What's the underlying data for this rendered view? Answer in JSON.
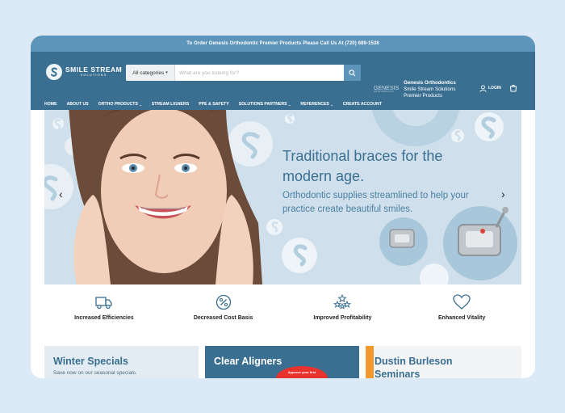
{
  "announcement": "To Order Genesis Orthodontic Premier Products Please Call Us At (720) 689-1536",
  "logo": {
    "line1": "SMILE STREAM",
    "line2": "SOLUTIONS"
  },
  "search": {
    "category": "All categories",
    "placeholder": "What are you looking for?"
  },
  "partner": {
    "logo_main": "GENESIS",
    "logo_sub": "ORTHODONTICS",
    "title": "Genesis Orthodontics",
    "line2": "Smile Stream Solutions",
    "line3": "Premier Products"
  },
  "account": {
    "login": "LOGIN"
  },
  "nav": [
    {
      "label": "HOME"
    },
    {
      "label": "ABOUT US"
    },
    {
      "label": "ORTHO PRODUCTS",
      "dropdown": "⌄"
    },
    {
      "label": "STREAM LIGNERS"
    },
    {
      "label": "PPE & SAFETY"
    },
    {
      "label": "SOLUTIONS PARTNERS",
      "dropdown": "⌄"
    },
    {
      "label": "REFERENCES",
      "dropdown": "⌄"
    },
    {
      "label": "CREATE ACCOUNT"
    }
  ],
  "hero": {
    "title": "Traditional braces for the modern age.",
    "subtitle": "Orthodontic supplies streamlined to help your practice create beautiful smiles.",
    "prev": "‹",
    "next": "›"
  },
  "features": [
    {
      "label": "Increased Efficiencies",
      "icon": "truck-icon"
    },
    {
      "label": "Decreased Cost Basis",
      "icon": "percent-badge-icon"
    },
    {
      "label": "Improved Profitability",
      "icon": "stars-icon"
    },
    {
      "label": "Enhanced Vitality",
      "icon": "heart-icon"
    }
  ],
  "cards": [
    {
      "title": "Winter Specials",
      "subtitle": "Save now on our seasonal specials."
    },
    {
      "title": "Clear Aligners",
      "badge": "Approve your first"
    },
    {
      "title": "Dustin Burleson Seminars"
    }
  ],
  "colors": {
    "brand": "#3a6f91",
    "accent": "#5d94b9",
    "background": "#dce9f7"
  }
}
